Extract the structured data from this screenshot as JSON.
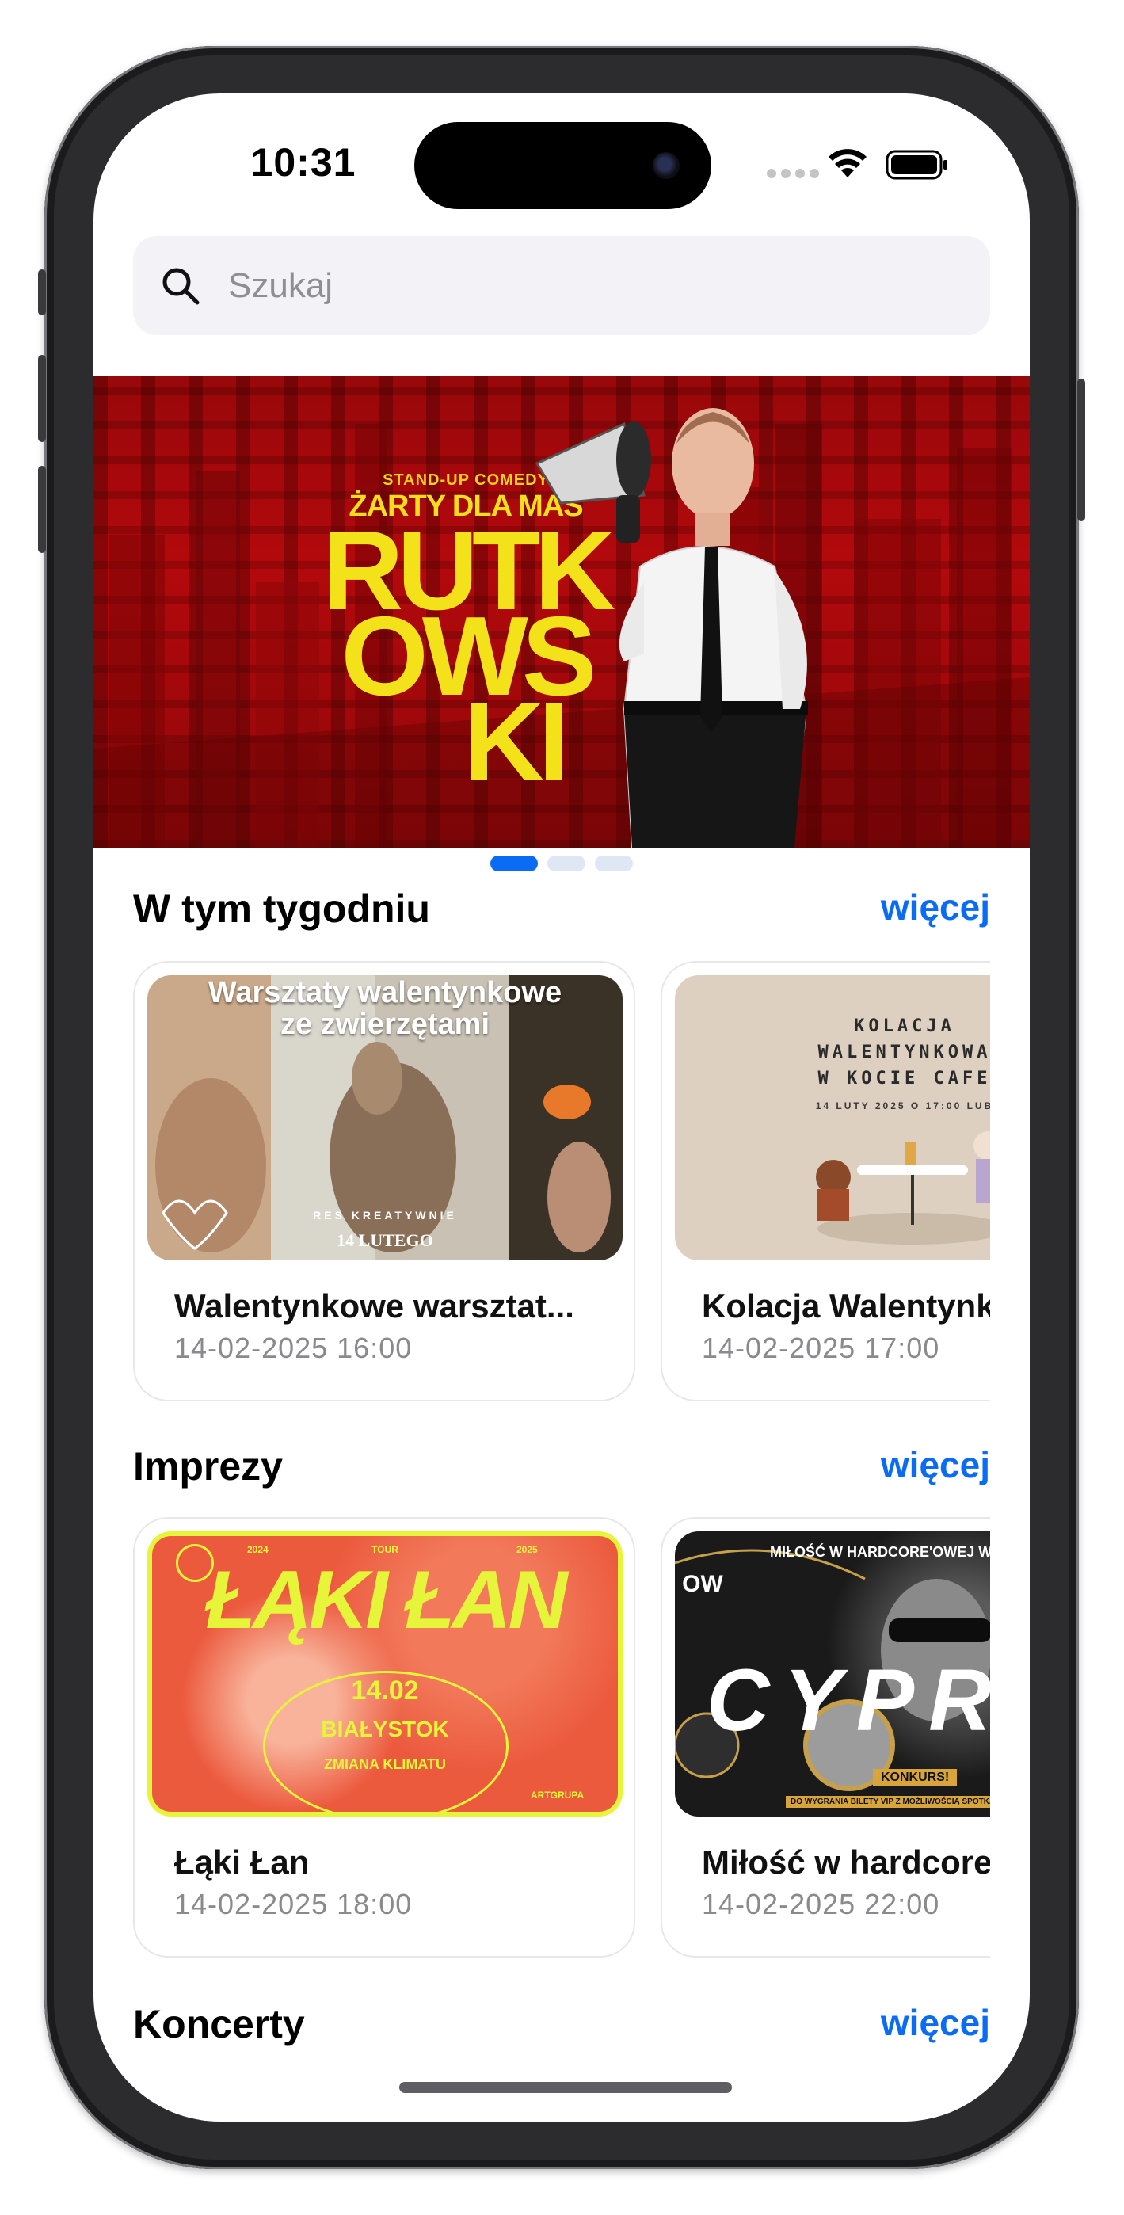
{
  "status_bar": {
    "time": "10:31"
  },
  "search": {
    "placeholder": "Szukaj"
  },
  "banner": {
    "kicker": "STAND-UP COMEDY",
    "subtitle": "ŻARTY DLA MAS",
    "title_lines": [
      "RUTK",
      "OWS",
      "KI"
    ],
    "pages_total": 3,
    "active_page": 1
  },
  "sections": [
    {
      "title": "W tym tygodniu",
      "more_label": "więcej",
      "events": [
        {
          "title": "Walentynkowe warsztat...",
          "date": "14-02-2025 16:00",
          "poster": {
            "headline": "Warsztaty walentynkowe\nze zwierzętami",
            "footer": "RES KREATYWNIE",
            "date": "14 LUTEGO"
          }
        },
        {
          "title": "Kolacja Walentynk",
          "date": "14-02-2025 17:00",
          "poster": {
            "headline": "KOLACJA\nWALENTYNKOWA\nW KOCIE CAFE",
            "footer": "14 LUTY 2025 O 17:00 LUB"
          }
        }
      ]
    },
    {
      "title": "Imprezy",
      "more_label": "więcej",
      "events": [
        {
          "title": "Łąki Łan",
          "date": "14-02-2025 18:00",
          "poster": {
            "headline": "ŁĄKI ŁAN",
            "top_left": "2024",
            "top_mid": "TOUR",
            "top_right": "2025",
            "date": "14.02",
            "city": "BIAŁYSTOK",
            "tagline": "ZMIANA KLIMATU",
            "brand": "ARTGRUPA"
          }
        },
        {
          "title": "Miłość w hardcore",
          "date": "14-02-2025 22:00",
          "poster": {
            "headline": "MIŁOŚĆ W HARDCORE'OWEJ W",
            "big": "CYPR",
            "badge": "KONKURS!",
            "footer": "DO WYGRANIA BILETY VIP Z MOŻLIWOŚCIĄ SPOTKANIA Z",
            "corner": "OW"
          }
        }
      ]
    },
    {
      "title": "Koncerty",
      "more_label": "więcej"
    }
  ],
  "colors": {
    "accent": "#0a6cf5",
    "banner_red": "#b3090c",
    "banner_yellow": "#f3e21a"
  },
  "icons": {
    "search": "magnifier",
    "wifi": "wifi",
    "battery": "battery-full"
  }
}
